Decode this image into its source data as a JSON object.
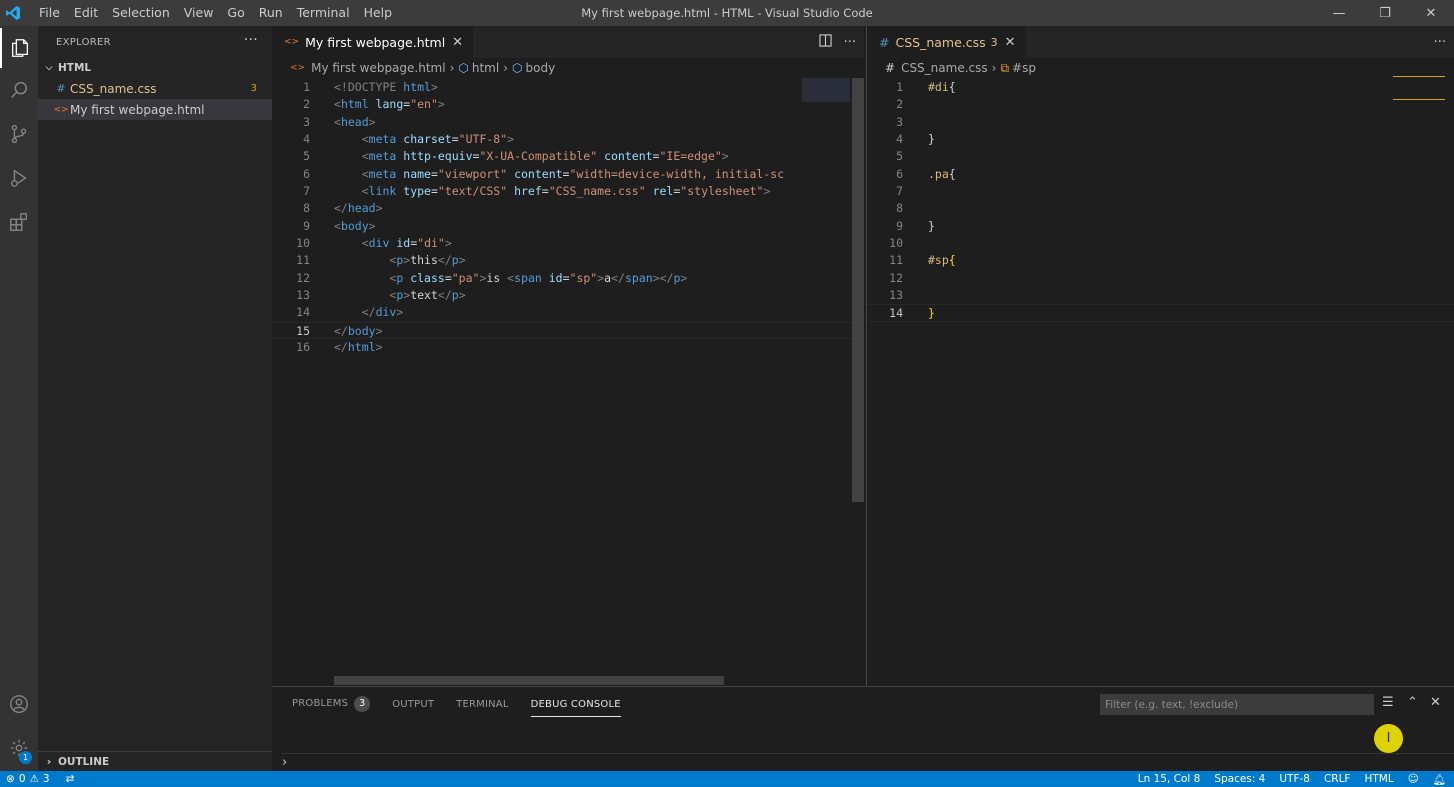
{
  "titlebar": {
    "menu": [
      "File",
      "Edit",
      "Selection",
      "View",
      "Go",
      "Run",
      "Terminal",
      "Help"
    ],
    "title": "My first webpage.html - HTML - Visual Studio Code",
    "controls": [
      "—",
      "❐",
      "✕"
    ]
  },
  "activitybar": {
    "settings_badge": "1"
  },
  "sidebar": {
    "header": "EXPLORER",
    "more": "···",
    "folder": "HTML",
    "files": [
      {
        "icon": "#",
        "name": "CSS_name.css",
        "problems": "3",
        "color": "#e2c08d"
      },
      {
        "icon": "<>",
        "name": "My first webpage.html",
        "problems": "",
        "color": "#cccccc"
      }
    ],
    "outline": "OUTLINE"
  },
  "editor1": {
    "tab": {
      "icon": "<>",
      "label": "My first webpage.html",
      "close": "✕"
    },
    "breadcrumb": [
      "My first webpage.html",
      "html",
      "body"
    ],
    "current_line": 15,
    "lines": [
      [
        [
          "k",
          "<!DOCTYPE "
        ],
        [
          "t",
          "html"
        ],
        [
          "k",
          ">"
        ]
      ],
      [
        [
          "k",
          "<"
        ],
        [
          "t",
          "html "
        ],
        [
          "a",
          "lang"
        ],
        [
          "p",
          "="
        ],
        [
          "s",
          "\"en\""
        ],
        [
          "k",
          ">"
        ]
      ],
      [
        [
          "k",
          "<"
        ],
        [
          "t",
          "head"
        ],
        [
          "k",
          ">"
        ]
      ],
      [
        [
          "p",
          "    "
        ],
        [
          "k",
          "<"
        ],
        [
          "t",
          "meta "
        ],
        [
          "a",
          "charset"
        ],
        [
          "p",
          "="
        ],
        [
          "s",
          "\"UTF-8\""
        ],
        [
          "k",
          ">"
        ]
      ],
      [
        [
          "p",
          "    "
        ],
        [
          "k",
          "<"
        ],
        [
          "t",
          "meta "
        ],
        [
          "a",
          "http-equiv"
        ],
        [
          "p",
          "="
        ],
        [
          "s",
          "\"X-UA-Compatible\" "
        ],
        [
          "a",
          "content"
        ],
        [
          "p",
          "="
        ],
        [
          "s",
          "\"IE=edge\""
        ],
        [
          "k",
          ">"
        ]
      ],
      [
        [
          "p",
          "    "
        ],
        [
          "k",
          "<"
        ],
        [
          "t",
          "meta "
        ],
        [
          "a",
          "name"
        ],
        [
          "p",
          "="
        ],
        [
          "s",
          "\"viewport\" "
        ],
        [
          "a",
          "content"
        ],
        [
          "p",
          "="
        ],
        [
          "s",
          "\"width=device-width, initial-sc"
        ]
      ],
      [
        [
          "p",
          "    "
        ],
        [
          "k",
          "<"
        ],
        [
          "t",
          "link "
        ],
        [
          "a",
          "type"
        ],
        [
          "p",
          "="
        ],
        [
          "s",
          "\"text/CSS\" "
        ],
        [
          "a",
          "href"
        ],
        [
          "p",
          "="
        ],
        [
          "s",
          "\"CSS_name.css\" "
        ],
        [
          "a",
          "rel"
        ],
        [
          "p",
          "="
        ],
        [
          "s",
          "\"stylesheet\""
        ],
        [
          "k",
          ">"
        ]
      ],
      [
        [
          "k",
          "</"
        ],
        [
          "t",
          "head"
        ],
        [
          "k",
          ">"
        ]
      ],
      [
        [
          "k",
          "<"
        ],
        [
          "t",
          "body"
        ],
        [
          "k",
          ">"
        ]
      ],
      [
        [
          "p",
          "    "
        ],
        [
          "k",
          "<"
        ],
        [
          "t",
          "div "
        ],
        [
          "a",
          "id"
        ],
        [
          "p",
          "="
        ],
        [
          "s",
          "\"di\""
        ],
        [
          "k",
          ">"
        ]
      ],
      [
        [
          "p",
          "        "
        ],
        [
          "k",
          "<"
        ],
        [
          "t",
          "p"
        ],
        [
          "k",
          ">"
        ],
        [
          "p",
          "this"
        ],
        [
          "k",
          "</"
        ],
        [
          "t",
          "p"
        ],
        [
          "k",
          ">"
        ]
      ],
      [
        [
          "p",
          "        "
        ],
        [
          "k",
          "<"
        ],
        [
          "t",
          "p "
        ],
        [
          "a",
          "class"
        ],
        [
          "p",
          "="
        ],
        [
          "s",
          "\"pa\""
        ],
        [
          "k",
          ">"
        ],
        [
          "p",
          "is "
        ],
        [
          "k",
          "<"
        ],
        [
          "t",
          "span "
        ],
        [
          "a",
          "id"
        ],
        [
          "p",
          "="
        ],
        [
          "s",
          "\"sp\""
        ],
        [
          "k",
          ">"
        ],
        [
          "p",
          "a"
        ],
        [
          "k",
          "</"
        ],
        [
          "t",
          "span"
        ],
        [
          "k",
          "></"
        ],
        [
          "t",
          "p"
        ],
        [
          "k",
          ">"
        ]
      ],
      [
        [
          "p",
          "        "
        ],
        [
          "k",
          "<"
        ],
        [
          "t",
          "p"
        ],
        [
          "k",
          ">"
        ],
        [
          "p",
          "text"
        ],
        [
          "k",
          "</"
        ],
        [
          "t",
          "p"
        ],
        [
          "k",
          ">"
        ]
      ],
      [
        [
          "p",
          "    "
        ],
        [
          "k",
          "</"
        ],
        [
          "t",
          "div"
        ],
        [
          "k",
          ">"
        ]
      ],
      [
        [
          "k",
          "</"
        ],
        [
          "t",
          "body"
        ],
        [
          "k",
          ">"
        ]
      ],
      [
        [
          "k",
          "</"
        ],
        [
          "t",
          "html"
        ],
        [
          "k",
          ">"
        ]
      ]
    ]
  },
  "editor2": {
    "tab": {
      "icon": "#",
      "label": "CSS_name.css",
      "problems": "3",
      "close": "✕"
    },
    "breadcrumb": [
      "CSS_name.css",
      "#sp"
    ],
    "current_line": 14,
    "lines": [
      [
        [
          "sel",
          "#di"
        ],
        [
          "p",
          "{"
        ]
      ],
      [],
      [],
      [
        [
          "p",
          "}"
        ]
      ],
      [],
      [
        [
          "sel",
          ".pa"
        ],
        [
          "p",
          "{"
        ]
      ],
      [],
      [],
      [
        [
          "p",
          "}"
        ]
      ],
      [],
      [
        [
          "sel",
          "#sp"
        ],
        [
          "br",
          "{"
        ]
      ],
      [],
      [],
      [
        [
          "br",
          "}"
        ]
      ]
    ]
  },
  "panel": {
    "tabs": [
      "PROBLEMS",
      "OUTPUT",
      "TERMINAL",
      "DEBUG CONSOLE"
    ],
    "problems_count": "3",
    "active_tab": "DEBUG CONSOLE",
    "filter_placeholder": "Filter (e.g. text, !exclude)",
    "prompt": "›"
  },
  "statusbar": {
    "errors": "0",
    "warnings": "3",
    "position": "Ln 15, Col 8",
    "spaces": "Spaces: 4",
    "encoding": "UTF-8",
    "eol": "CRLF",
    "language": "HTML"
  },
  "colors": {
    "accent": "#007acc",
    "modified_file": "#e2c08d"
  }
}
